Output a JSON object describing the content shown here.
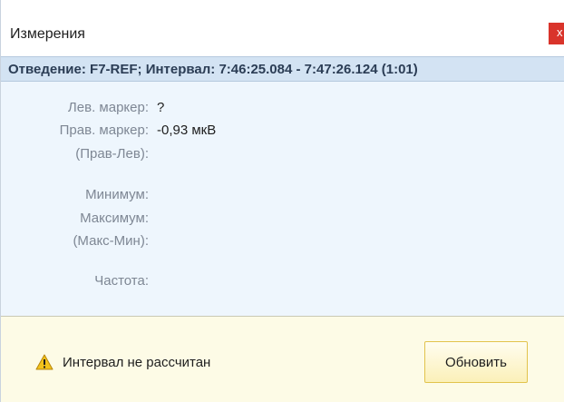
{
  "window": {
    "title": "Измерения",
    "close_label": "x"
  },
  "header": {
    "text": "Отведение: F7-REF; Интервал: 7:46:25.084 - 7:47:26.124 (1:01)"
  },
  "measurements": {
    "left_marker_label": "Лев. маркер:",
    "left_marker_value": "?",
    "right_marker_label": "Прав. маркер:",
    "right_marker_value": "-0,93 мкВ",
    "diff_label": "(Прав-Лев):",
    "min_label": "Минимум:",
    "max_label": "Максимум:",
    "maxmin_label": "(Макс-Мин):",
    "freq_label": "Частота:"
  },
  "footer": {
    "warning_text": "Интервал не рассчитан",
    "refresh_label": "Обновить",
    "warning_icon": "warning-triangle-icon"
  },
  "colors": {
    "header_band": "#d3e3f3",
    "content_bg": "#eef6fd",
    "footer_bg": "#fdfbe6",
    "close_button": "#d9342b",
    "warning_yellow": "#f2c21b"
  }
}
